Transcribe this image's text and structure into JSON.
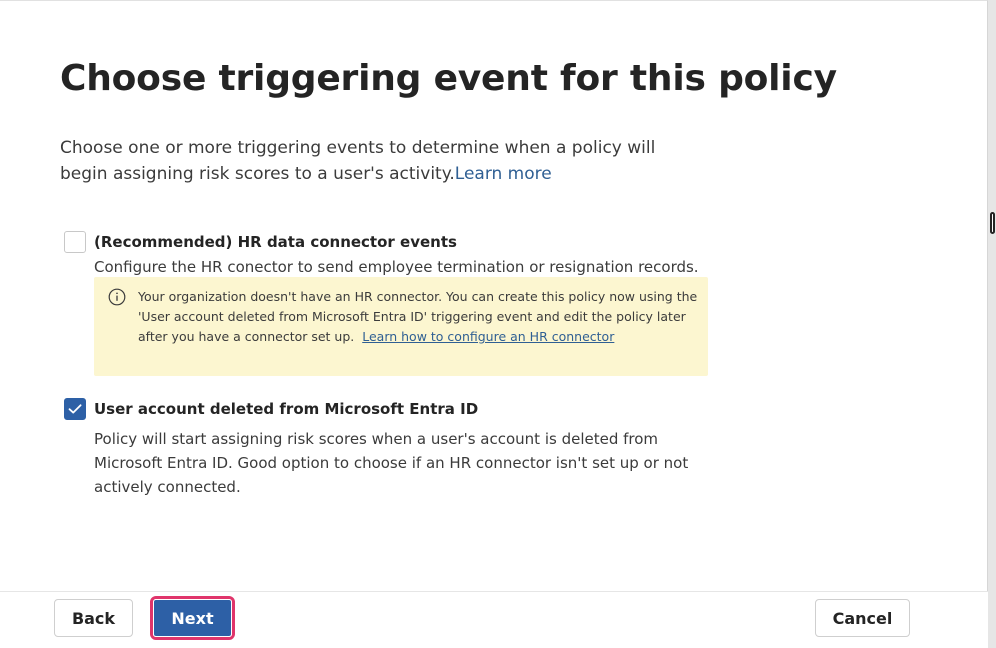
{
  "page": {
    "title": "Choose triggering event for this policy",
    "intro": "Choose one or more triggering events to determine when a policy will begin assigning risk scores to a user's activity.",
    "learn_more": "Learn more"
  },
  "options": [
    {
      "title": "(Recommended) HR data connector events",
      "description": "Configure the HR conector to send employee termination or resignation records.",
      "checked": false
    },
    {
      "title": "User account deleted from Microsoft Entra ID",
      "description": "Policy will start assigning risk scores when a user's account is deleted from Microsoft Entra ID. Good option to choose if an HR connector isn't set up or not actively connected.",
      "checked": true
    }
  ],
  "warning": {
    "icon": "info-icon",
    "text": "Your organization doesn't have an HR connector. You can create this policy now using the 'User account deleted from Microsoft Entra ID' triggering event and edit the policy later after you have a connector set up.",
    "link": "Learn how to configure an HR connector"
  },
  "footer": {
    "back_label": "Back",
    "next_label": "Next",
    "cancel_label": "Cancel"
  },
  "colors": {
    "accent": "#2d60a6",
    "link": "#2f5f93",
    "warning_bg": "#fcf6d0",
    "highlight": "#e0356b"
  }
}
